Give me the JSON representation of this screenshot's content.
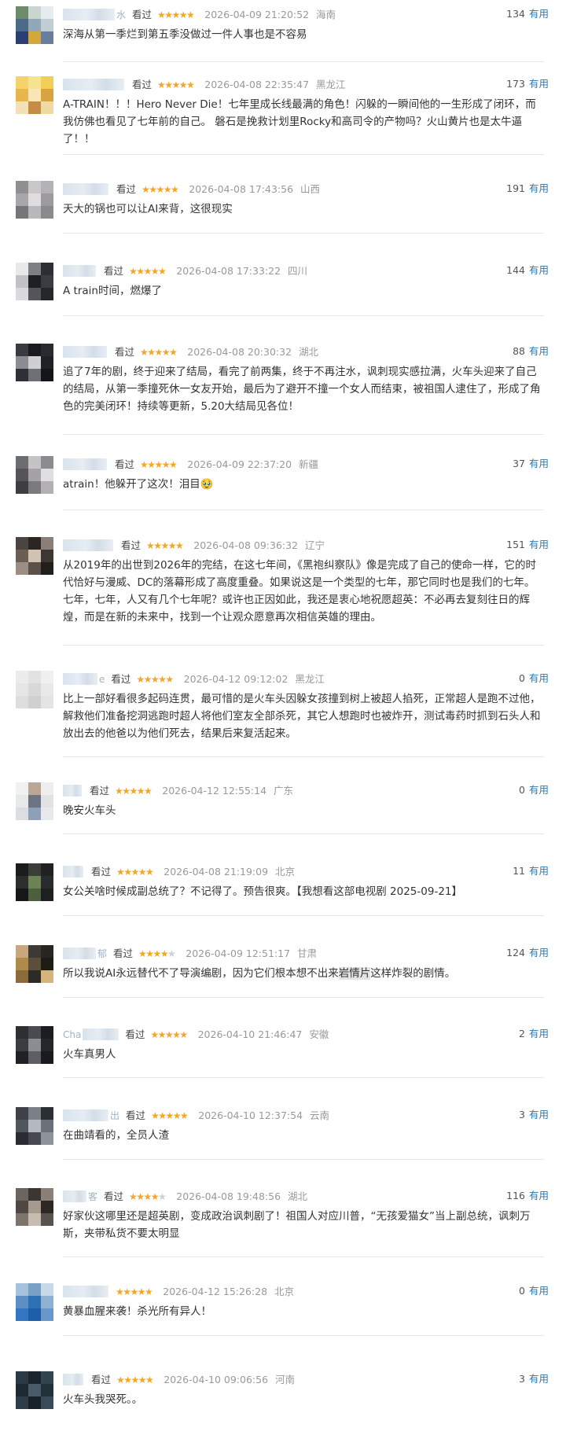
{
  "ui": {
    "watched": "看过",
    "useful": "有用"
  },
  "reviews": [
    {
      "name_tail": "水",
      "stars": 5,
      "time": "2026-04-09 21:20:52",
      "loc": "海南",
      "votes": "134",
      "content": "深海从第一季烂到第五季没做过一件人事也是不容易"
    },
    {
      "name_tail": "",
      "stars": 5,
      "time": "2026-04-08 22:35:47",
      "loc": "黑龙江",
      "votes": "173",
      "content": "A-TRAIN！！！Hero Never Die！七年里成长线最满的角色！闪躲的一瞬间他的一生形成了闭环，而我仿佛也看见了七年前的自己。 磐石是挽救计划里Rocky和高司令的产物吗？火山黄片也是太牛逼了！！"
    },
    {
      "name_tail": "",
      "stars": 5,
      "time": "2026-04-08 17:43:56",
      "loc": "山西",
      "votes": "191",
      "content": "天大的锅也可以让AI来背，这很现实"
    },
    {
      "name_tail": "",
      "stars": 5,
      "time": "2026-04-08 17:33:22",
      "loc": "四川",
      "votes": "144",
      "content": "A train时间，燃爆了"
    },
    {
      "name_tail": "",
      "stars": 5,
      "time": "2026-04-08 20:30:32",
      "loc": "湖北",
      "votes": "88",
      "content": "追了7年的剧，终于迎来了结局，看完了前两集，终于不再注水，讽刺现实感拉满，火车头迎来了自己的结局，从第一季撞死休一女友开始，最后为了避开不撞一个女人而结束，被祖国人逮住了，形成了角色的完美闭环！持续等更新，5.20大结局见各位！"
    },
    {
      "name_tail": "",
      "stars": 5,
      "time": "2026-04-09 22:37:20",
      "loc": "新疆",
      "votes": "37",
      "content": "atrain！他躲开了这次！泪目🥹"
    },
    {
      "name_tail": "",
      "stars": 5,
      "time": "2026-04-08 09:36:32",
      "loc": "辽宁",
      "votes": "151",
      "content": "从2019年的出世到2026年的完结，在这七年间，《黑袍纠察队》像是完成了自己的使命一样，它的时代恰好与漫威、DC的落幕形成了高度重叠。如果说这是一个类型的七年，那它同时也是我们的七年。七年，七年，人又有几个七年呢？或许也正因如此，我还是衷心地祝愿超英：不必再去复刻往日的辉煌，而是在新的未来中，找到一个让观众愿意再次相信英雄的理由。"
    },
    {
      "name_tail": "e",
      "stars": 5,
      "time": "2026-04-12 09:12:02",
      "loc": "黑龙江",
      "votes": "0",
      "content": "比上一部好看很多起码连贯，最可惜的是火车头因躲女孩撞到树上被超人掐死，正常超人是跑不过他，解救他们准备挖洞逃跑时超人将他们室友全部杀死，其它人想跑时也被炸开，测试毒药时抓到石头人和放出去的他爸以为他们死去，结果后来复活起来。"
    },
    {
      "name_tail": "",
      "stars": 5,
      "time": "2026-04-12 12:55:14",
      "loc": "广东",
      "votes": "0",
      "content": "晚安火车头"
    },
    {
      "name_tail": "",
      "stars": 5,
      "time": "2026-04-08 21:19:09",
      "loc": "北京",
      "votes": "11",
      "content": "女公关啥时候成副总统了？不记得了。预告很爽。【我想看这部电视剧 2025-09-21】"
    },
    {
      "name_tail": "郁",
      "stars": 4,
      "time": "2026-04-09 12:51:17",
      "loc": "甘肃",
      "votes": "124",
      "content_pre": "所以我说AI永远替代不了导演编剧，因为它们根本想不出来",
      "content_hl": "岩情片",
      "content_post": "这样炸裂的剧情。"
    },
    {
      "name_tail": "",
      "name_prefix": "Cha",
      "stars": 5,
      "time": "2026-04-10 21:46:47",
      "loc": "安徽",
      "votes": "2",
      "content": "火车真男人"
    },
    {
      "name_tail": "出",
      "stars": 5,
      "time": "2026-04-10 12:37:54",
      "loc": "云南",
      "votes": "3",
      "content": "在曲靖看的，全员人渣"
    },
    {
      "name_tail": "客",
      "stars": 4,
      "time": "2026-04-08 19:48:56",
      "loc": "湖北",
      "votes": "116",
      "content": "好家伙这哪里还是超英剧，变成政治讽刺剧了！祖国人对应川普，“无孩爱猫女”当上副总统，讽刺万斯，夹带私货不要太明显"
    },
    {
      "name_tail": "",
      "stars": 5,
      "time": "2026-04-12 15:26:28",
      "loc": "北京",
      "votes": "0",
      "content": "黄暴血腥来袭！杀光所有异人！"
    },
    {
      "name_tail": "",
      "stars": 5,
      "time": "2026-04-10 09:06:56",
      "loc": "河南",
      "votes": "3",
      "content": "火车头我哭死。。"
    }
  ]
}
